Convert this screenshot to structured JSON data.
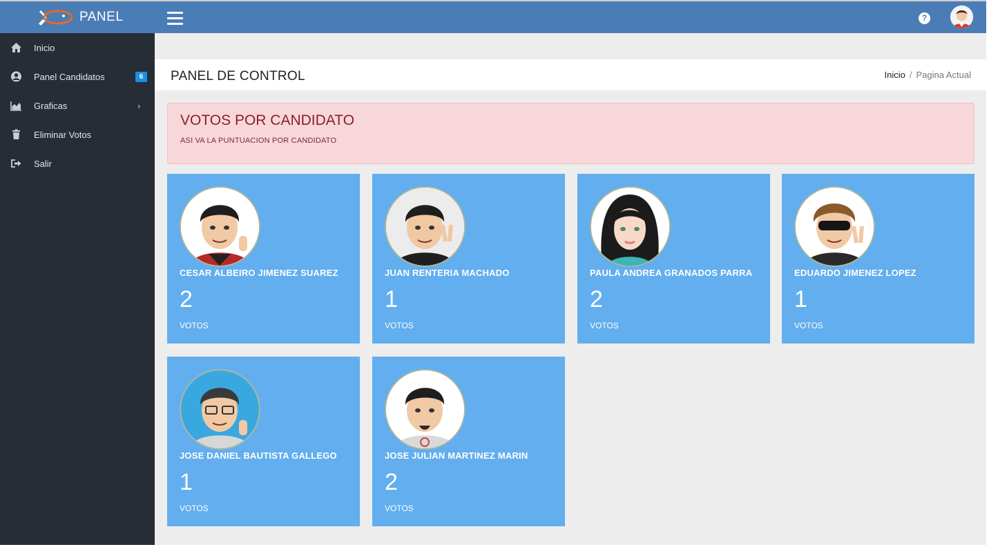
{
  "brand": {
    "name": "PANEL",
    "logo_icon": "fish-icon"
  },
  "topbar": {
    "menu_icon": "hamburger-icon",
    "help_icon": "question-icon",
    "user_icon": "user-avatar"
  },
  "sidebar": {
    "items": [
      {
        "label": "Inicio",
        "icon": "home-icon"
      },
      {
        "label": "Panel Candidatos",
        "icon": "user-circle-icon",
        "badge": "6"
      },
      {
        "label": "Graficas",
        "icon": "area-chart-icon",
        "chevron": "›"
      },
      {
        "label": "Eliminar Votos",
        "icon": "trash-icon"
      },
      {
        "label": "Salir",
        "icon": "sign-out-icon"
      }
    ]
  },
  "header": {
    "title": "PANEL DE CONTROL",
    "breadcrumb": {
      "home": "Inicio",
      "separator": "/",
      "current": "Pagina Actual"
    }
  },
  "alert": {
    "title": "VOTOS POR CANDIDATO",
    "subtitle": "ASI VA LA PUNTUACION POR CANDIDATO"
  },
  "candidates": [
    {
      "name": "CESAR ALBEIRO JIMENEZ SUAREZ",
      "votes": "2",
      "votes_label": "VOTOS"
    },
    {
      "name": "JUAN RENTERIA MACHADO",
      "votes": "1",
      "votes_label": "VOTOS"
    },
    {
      "name": "PAULA ANDREA GRANADOS PARRA",
      "votes": "2",
      "votes_label": "VOTOS"
    },
    {
      "name": "EDUARDO JIMENEZ LOPEZ",
      "votes": "1",
      "votes_label": "VOTOS"
    },
    {
      "name": "JOSE DANIEL BAUTISTA GALLEGO",
      "votes": "1",
      "votes_label": "VOTOS"
    },
    {
      "name": "JOSE JULIAN MARTINEZ MARIN",
      "votes": "2",
      "votes_label": "VOTOS"
    }
  ],
  "colors": {
    "topbar": "#4a7db5",
    "sidebar": "#262d35",
    "card": "#62aeee",
    "alert_bg": "#f8d7da",
    "badge": "#1e8fe0"
  }
}
